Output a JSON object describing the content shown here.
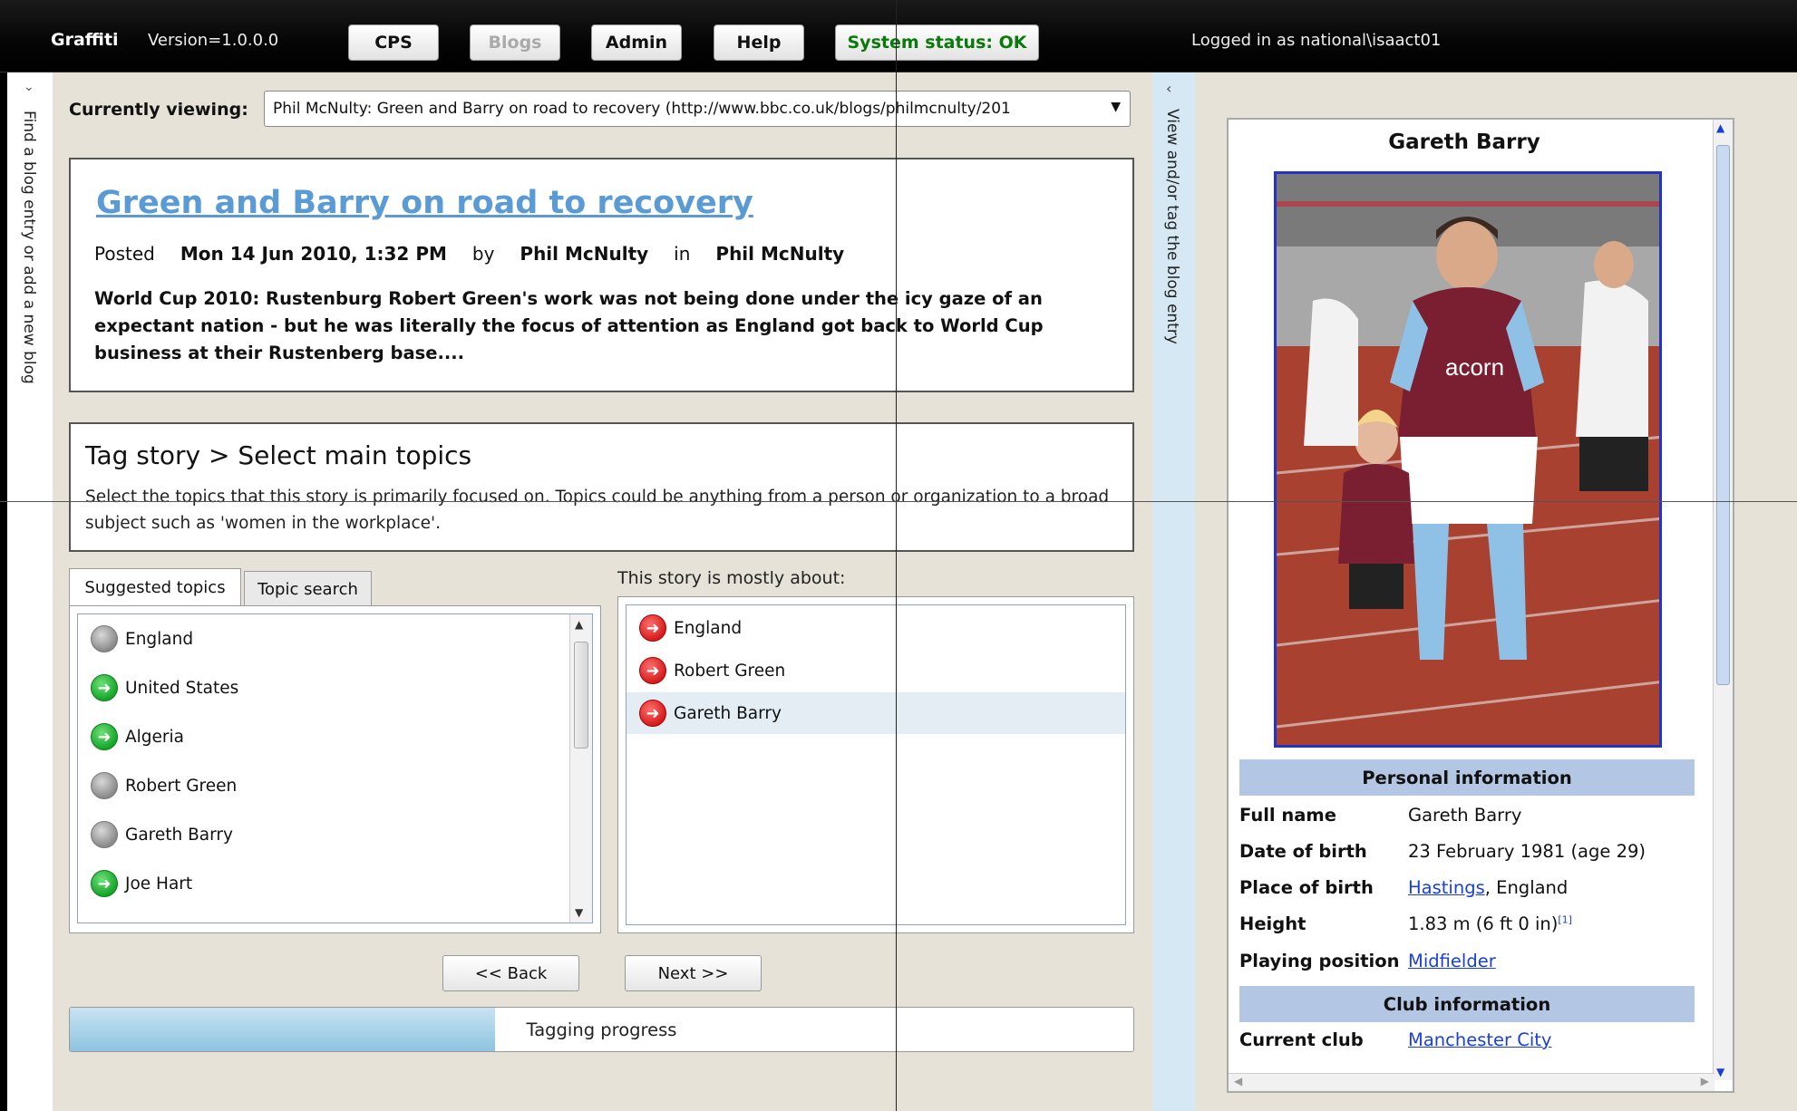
{
  "topbar": {
    "brand": "Graffiti",
    "version": "Version=1.0.0.0",
    "buttons": [
      "CPS",
      "Blogs",
      "Admin",
      "Help"
    ],
    "status": "System status: OK",
    "logged_in": "Logged in as national\\isaact01"
  },
  "left_panel": {
    "label": "Find a blog entry or add a new blog"
  },
  "right_panel": {
    "label": "View and/or tag the blog entry"
  },
  "viewing": {
    "label": "Currently viewing:",
    "value": "Phil McNulty: Green and Barry on road to recovery (http://www.bbc.co.uk/blogs/philmcnulty/201"
  },
  "article": {
    "title": "Green and Barry on road to recovery",
    "posted_label": "Posted",
    "date": "Mon 14 Jun 2010, 1:32 PM",
    "by_label": "by",
    "author": "Phil McNulty",
    "in_label": "in",
    "blog": "Phil McNulty",
    "summary": "World Cup 2010: Rustenburg Robert Green's work was not being done under the icy gaze of an expectant nation - but he was literally the focus of attention as England got back to World Cup business at their Rustenberg base...."
  },
  "tag_story": {
    "crumb": "Tag story >  Select main topics",
    "description": "Select the topics that this story is primarily focused on. Topics could be anything from a person or organization to a broad subject such as 'women in the workplace'."
  },
  "tabs": {
    "suggested": "Suggested topics",
    "search": "Topic search"
  },
  "suggested_topics": [
    {
      "label": "England",
      "icon": "gray-circle-icon"
    },
    {
      "label": "United States",
      "icon": "green-arrow-icon"
    },
    {
      "label": "Algeria",
      "icon": "green-arrow-icon"
    },
    {
      "label": "Robert Green",
      "icon": "gray-circle-icon"
    },
    {
      "label": "Gareth Barry",
      "icon": "gray-circle-icon"
    },
    {
      "label": "Joe Hart",
      "icon": "green-arrow-icon"
    }
  ],
  "about": {
    "label": "This story is mostly about:",
    "items": [
      "England",
      "Robert Green",
      "Gareth Barry"
    ],
    "selected": "Gareth Barry"
  },
  "nav": {
    "back": "<< Back",
    "next": "Next >>"
  },
  "progress": {
    "label": "Tagging progress",
    "value": 0.4
  },
  "wiki": {
    "title": "Gareth Barry",
    "personal_header": "Personal information",
    "rows": [
      {
        "key": "Full name",
        "value": "Gareth Barry"
      },
      {
        "key": "Date of birth",
        "value": "23 February 1981 (age 29)"
      },
      {
        "key": "Place of birth",
        "link": "Hastings",
        "value": ", England"
      },
      {
        "key": "Height",
        "value": "1.83 m (6 ft 0 in)",
        "note": "[1]"
      },
      {
        "key": "Playing position",
        "link": "Midfielder"
      }
    ],
    "club_header": "Club information",
    "club_rows": [
      {
        "key": "Current club",
        "link": "Manchester City"
      }
    ],
    "photo_text": "acorn"
  },
  "colors": {
    "link": "#5b9bd5",
    "status_ok": "#0a7a0a",
    "accent_blue": "#b3c6e3"
  }
}
